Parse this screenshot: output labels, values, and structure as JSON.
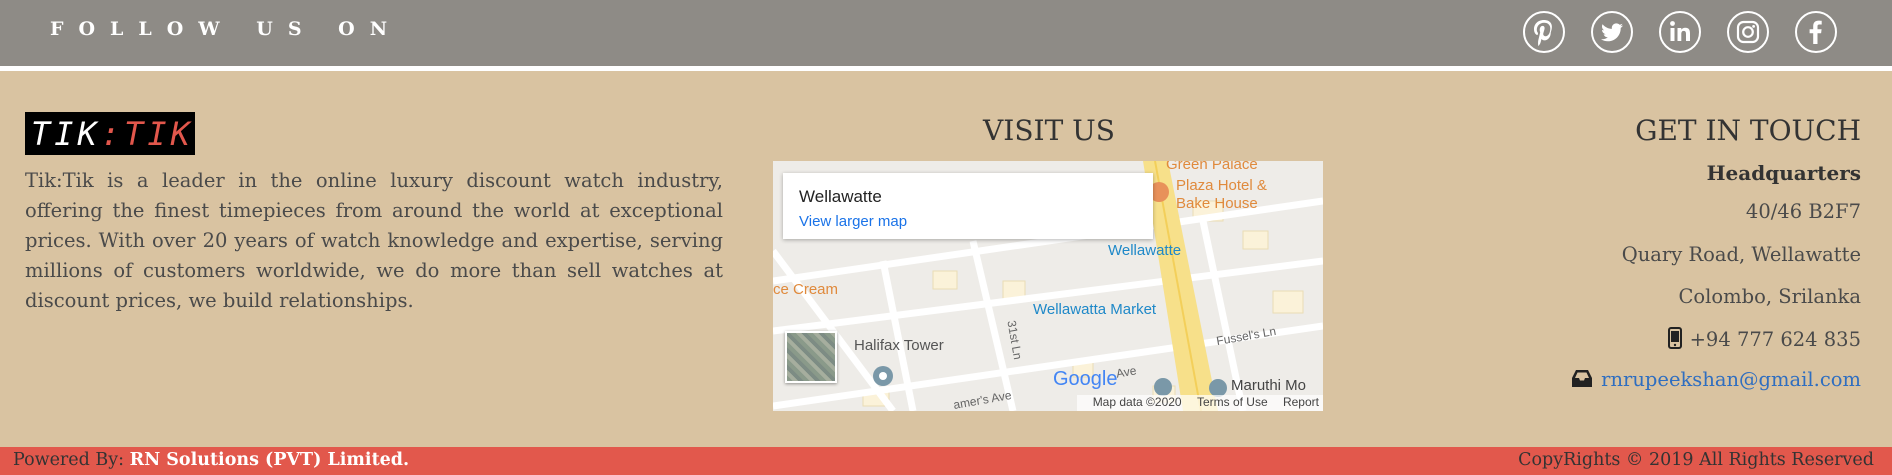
{
  "header": {
    "follow_text": "FOLLOW US ON",
    "social_icons": [
      "pinterest-icon",
      "twitter-icon",
      "linkedin-icon",
      "instagram-icon",
      "facebook-icon"
    ]
  },
  "logo": {
    "part1": "TIK",
    "part2": ":TIK"
  },
  "about": {
    "text": "Tik:Tik is a leader in the online luxury discount watch industry, offering the finest timepieces from around the world at exceptional prices. With over 20 years of watch knowledge and expertise, serving millions of customers worldwide, we do more than sell watches at discount prices, we build relationships."
  },
  "visit": {
    "title": "VISIT US",
    "map": {
      "place": "Wellawatte",
      "larger_map": "View larger map",
      "labels": {
        "green_palace": "Green Palace",
        "plaza_hotel": "Plaza Hotel &",
        "bake_house": "Bake House",
        "wellawatte_station": "Wellawatte",
        "ice_cream": "ce Cream",
        "wellawatta_market": "Wellawatta Market",
        "halifax_tower": "Halifax Tower",
        "fussels_ln": "Fussel's Ln",
        "first_st_ln": "31st Ln",
        "havelock_ave": "Ave",
        "maruthi": "Maruthi Mo",
        "lamers_ave": "amer's Ave"
      },
      "google_logo": "Google",
      "map_data": "Map data ©2020",
      "terms": "Terms of Use",
      "report": "Report"
    }
  },
  "contact": {
    "title": "GET IN TOUCH",
    "headquarters": "Headquarters",
    "address_line1": "40/46 B2F7",
    "address_line2": "Quary Road, Wellawatte",
    "address_line3": "Colombo, Srilanka",
    "phone": "+94 777 624 835",
    "email": "rnrupeekshan@gmail.com"
  },
  "footer": {
    "powered_by": "Powered By:",
    "company": "RN Solutions (PVT) Limited.",
    "copyright": "CopyRights © 2019 All Rights Reserved"
  },
  "colors": {
    "follow_bar": "#8e8b86",
    "body_bg": "#d9c3a1",
    "footer_bar": "#e2584c",
    "email_link": "#2f6ec0",
    "logo_red": "#e2574c"
  }
}
